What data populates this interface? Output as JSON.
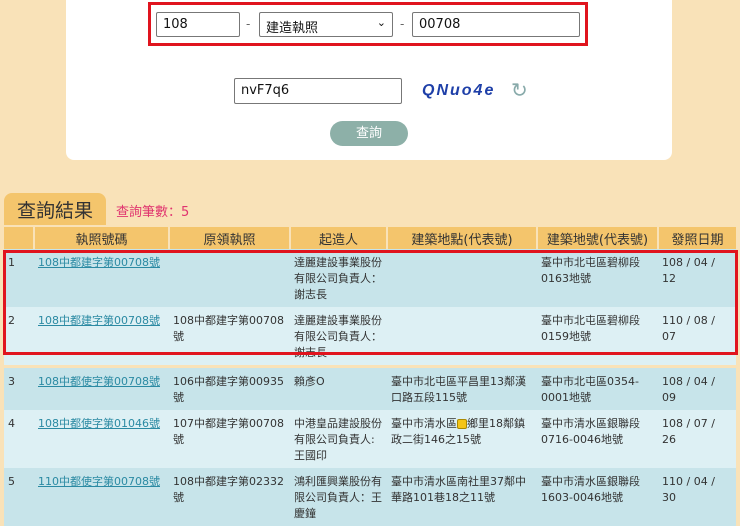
{
  "search": {
    "year": "108",
    "type": "建造執照",
    "number": "00708",
    "dash": "-",
    "captcha_input": "nvF7q6",
    "captcha_code": "QNuo4e",
    "submit_label": "查詢"
  },
  "results": {
    "tab_label": "查詢結果",
    "count_label": "查詢筆數：5",
    "headers": [
      "",
      "執照號碼",
      "原領執照",
      "起造人",
      "建築地點(代表號)",
      "建築地號(代表號)",
      "發照日期"
    ],
    "rows": [
      {
        "no": "1",
        "license": "108中都建字第00708號",
        "original": "",
        "applicant": "達麗建設事業股份有限公司負責人：謝志長",
        "location": "",
        "lot": "臺中市北屯區碧柳段0163地號",
        "date": "108 / 04 / 12"
      },
      {
        "no": "2",
        "license": "108中都建字第00708號",
        "original": "108中都建字第00708號",
        "applicant": "達麗建設事業股份有限公司負責人：謝志長",
        "location": "",
        "lot": "臺中市北屯區碧柳段0159地號",
        "date": "110 / 08 / 07"
      },
      {
        "no": "3",
        "license": "108中都使字第00708號",
        "original": "106中都建字第00935號",
        "applicant": "賴彥O",
        "location": "臺中市北屯區平昌里13鄰漢口路五段115號",
        "lot": "臺中市北屯區0354-0001地號",
        "date": "108 / 04 / 09"
      },
      {
        "no": "4",
        "license": "108中都使字第01046號",
        "original": "107中都建字第00708號",
        "applicant": "中港皇品建設股份有限公司負責人:王國印",
        "location_pre": "臺中市清水區",
        "location_post": "鄉里18鄰鎮政二街146之15號",
        "lot": "臺中市清水區銀聯段0716-0046地號",
        "date": "108 / 07 / 26"
      },
      {
        "no": "5",
        "license": "110中都使字第00708號",
        "original": "108中都建字第02332號",
        "applicant": "鴻利匯興業股份有限公司負責人：王慶鐘",
        "location": "臺中市清水區南社里37鄰中華路101巷18之11號",
        "lot": "臺中市清水區銀聯段1603-0046地號",
        "date": "110 / 04 / 30"
      }
    ]
  }
}
